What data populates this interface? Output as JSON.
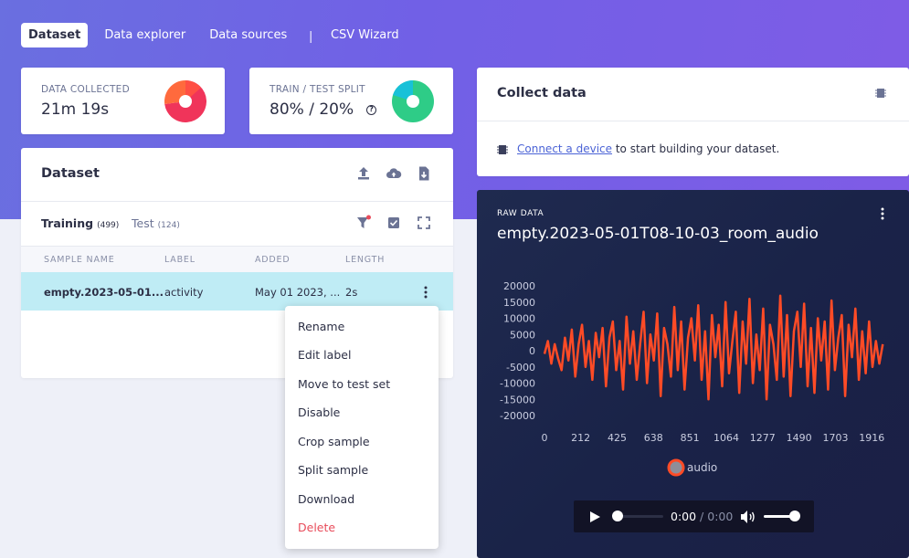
{
  "nav": {
    "tabs": [
      {
        "label": "Dataset",
        "active": true
      },
      {
        "label": "Data explorer"
      },
      {
        "label": "Data sources"
      },
      {
        "label": "CSV Wizard"
      }
    ],
    "separator": "|"
  },
  "stats": {
    "data_collected": {
      "label": "DATA COLLECTED",
      "value": "21m 19s"
    },
    "train_test_split": {
      "label": "TRAIN / TEST SPLIT",
      "value": "80% / 20%",
      "help_icon": "?"
    }
  },
  "dataset": {
    "title": "Dataset",
    "tabs": {
      "training": {
        "label": "Training",
        "count": "(499)"
      },
      "test": {
        "label": "Test",
        "count": "(124)"
      }
    },
    "columns": [
      "SAMPLE NAME",
      "LABEL",
      "ADDED",
      "LENGTH"
    ],
    "rows": [
      {
        "name": "empty.2023-05-01...",
        "label": "activity",
        "added": "May 01 2023, ...",
        "length": "2s"
      }
    ],
    "icons": [
      "upload-icon",
      "cloud-upload-icon",
      "file-export-icon",
      "filter-icon",
      "check-square-icon",
      "expand-icon"
    ]
  },
  "context_menu": {
    "items": [
      "Rename",
      "Edit label",
      "Move to test set",
      "Disable",
      "Crop sample",
      "Split sample",
      "Download",
      "Delete"
    ],
    "danger_item": "Delete",
    "danger_color": "#e84c5b"
  },
  "collect": {
    "title": "Collect data",
    "link_text": "Connect a device",
    "message_rest": " to start building your dataset."
  },
  "raw_data": {
    "label": "RAW DATA",
    "title": "empty.2023-05-01T08-10-03_room_audio",
    "legend_label": "audio"
  },
  "audio_player": {
    "time_current": "0:00",
    "time_separator": " / ",
    "time_total": "0:00",
    "volume_level": 0.85,
    "progress": 0
  },
  "colors": {
    "accent": "#6b62e2",
    "waveform": "#ff4b26",
    "highlight_row": "#bfecf5",
    "link": "#4b63d6"
  },
  "chart_data": {
    "type": "line",
    "yticks": [
      20000,
      15000,
      10000,
      5000,
      0,
      -5000,
      -10000,
      -15000,
      -20000
    ],
    "xticks": [
      0,
      212,
      425,
      638,
      851,
      1064,
      1277,
      1490,
      1703,
      1916
    ],
    "ylim": [
      -20000,
      20000
    ],
    "xlim": [
      0,
      2000
    ],
    "grid": false,
    "legend": "bottom-center",
    "series": [
      {
        "name": "audio",
        "color": "#ff4b26",
        "x_start": 0,
        "x_step": 20,
        "values": [
          -1000,
          3000,
          -4000,
          2000,
          -2500,
          -6000,
          4000,
          -3000,
          6500,
          -8000,
          2000,
          8000,
          -5000,
          3000,
          -9000,
          5500,
          -2000,
          7000,
          -11000,
          4000,
          9000,
          -6000,
          3000,
          -12000,
          10500,
          -4000,
          6000,
          -9000,
          2000,
          12000,
          -10000,
          5000,
          -3000,
          11500,
          -14000,
          7000,
          2000,
          -8000,
          13500,
          -6000,
          9000,
          -12000,
          4000,
          10000,
          -3000,
          14000,
          -9000,
          6000,
          -15000,
          11000,
          -2000,
          8000,
          -11000,
          15000,
          -7000,
          3000,
          12000,
          -13000,
          9000,
          -4000,
          16000,
          -10000,
          5000,
          -6000,
          13000,
          -15000,
          8000,
          2000,
          -9000,
          17000,
          -8000,
          11000,
          -14000,
          6000,
          12000,
          -5000,
          14500,
          -11000,
          7000,
          -13000,
          10000,
          -3000,
          9000,
          -12000,
          15500,
          -6000,
          4000,
          11000,
          -14000,
          8000,
          -2000,
          13000,
          -9000,
          6000,
          -7000,
          9000,
          -5000,
          3000,
          -4000,
          2000
        ]
      }
    ]
  }
}
